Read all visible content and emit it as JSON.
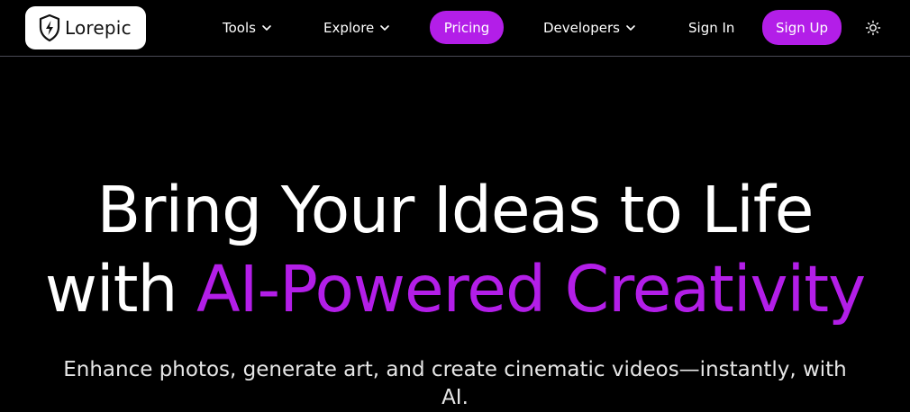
{
  "brand": {
    "name": "Lorepic",
    "icon": "shield-bolt-icon"
  },
  "nav": {
    "tools": "Tools",
    "explore": "Explore",
    "pricing": "Pricing",
    "developers": "Developers",
    "sign_in": "Sign In",
    "sign_up": "Sign Up",
    "theme_icon": "sun-icon"
  },
  "hero": {
    "title_line1": "Bring Your Ideas to Life",
    "title_line2_prefix": "with ",
    "title_line2_accent": "AI-Powered Creativity",
    "subtitle": "Enhance photos, generate art, and create cinematic videos—instantly, with AI."
  },
  "colors": {
    "background": "#000000",
    "accent": "#b31ee8",
    "text": "#ffffff",
    "divider": "#4a4a55"
  }
}
